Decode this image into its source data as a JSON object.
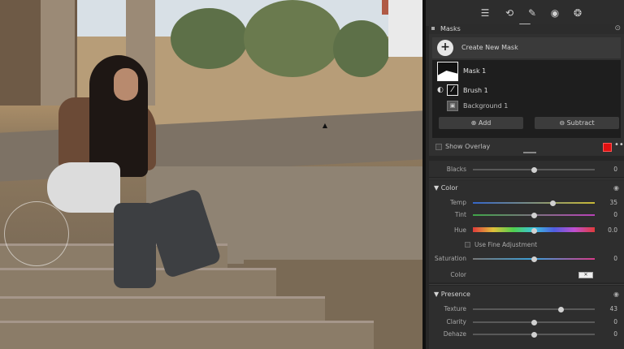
{
  "toolbar": {
    "icons": [
      "sliders-icon",
      "crop-icon",
      "healing-brush-icon",
      "red-eye-icon",
      "masking-icon"
    ]
  },
  "masks_panel": {
    "title": "Masks",
    "create_label": "Create New Mask",
    "mask1_label": "Mask 1",
    "brush1_label": "Brush 1",
    "background_label": "Background 1",
    "add_label": "Add",
    "subtract_label": "Subtract",
    "show_overlay_label": "Show Overlay",
    "overlay_color": "#e01010"
  },
  "blacks": {
    "label": "Blacks",
    "value": "0",
    "level": 0.5
  },
  "color_section": {
    "title": "Color",
    "temp": {
      "label": "Temp",
      "value": "35",
      "level": 0.65
    },
    "tint": {
      "label": "Tint",
      "value": "0",
      "level": 0.5
    },
    "hue": {
      "label": "Hue",
      "value": "0.0",
      "level": 0.5
    },
    "fine_adjust_label": "Use Fine Adjustment",
    "saturation": {
      "label": "Saturation",
      "value": "0",
      "level": 0.5
    },
    "color_label": "Color"
  },
  "presence_section": {
    "title": "Presence",
    "texture": {
      "label": "Texture",
      "value": "43",
      "level": 0.72
    },
    "clarity": {
      "label": "Clarity",
      "value": "0",
      "level": 0.5
    },
    "dehaze": {
      "label": "Dehaze",
      "value": "0",
      "level": 0.5
    }
  }
}
